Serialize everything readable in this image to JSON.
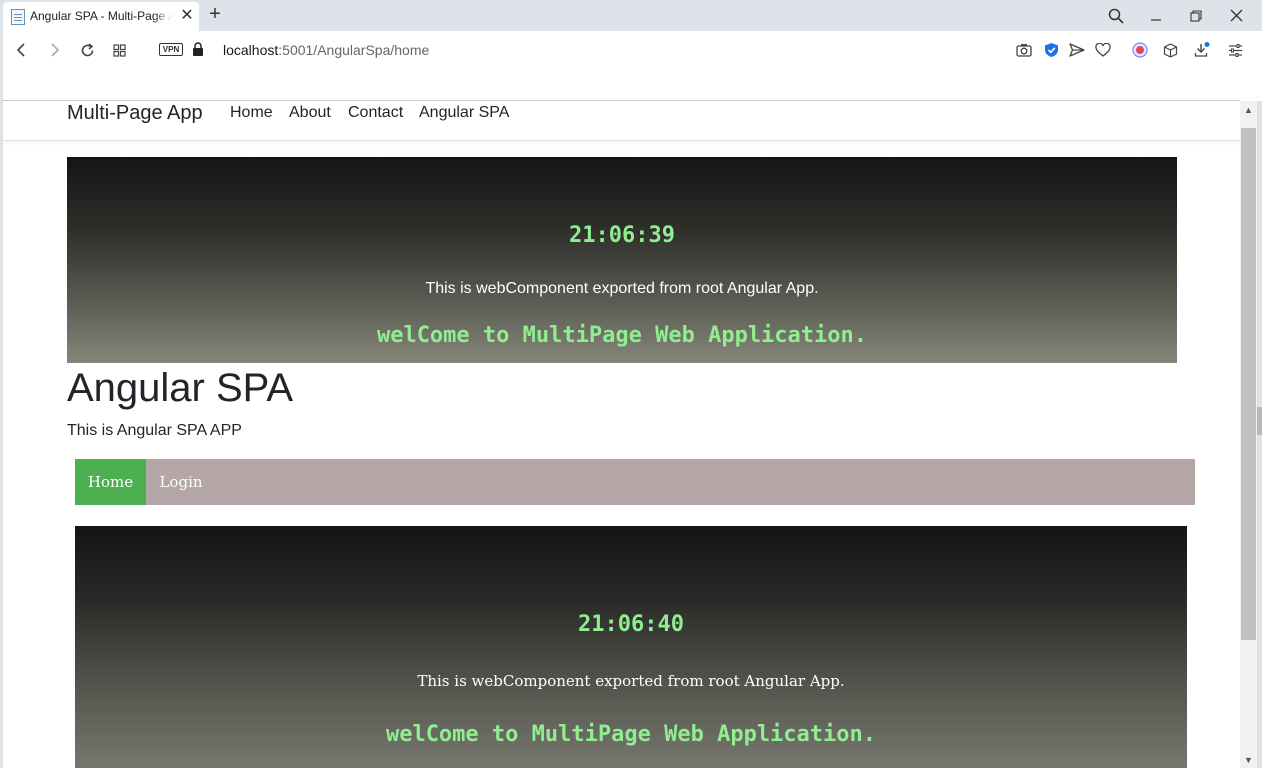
{
  "browser": {
    "tab_title": "Angular SPA - Multi-Page App",
    "new_tab_icon": "plus-icon",
    "url_host": "localhost",
    "url_path": ":5001/AngularSpa/home",
    "vpn_label": "VPN"
  },
  "navbar": {
    "brand": "Multi-Page App",
    "links": [
      "Home",
      "About",
      "Contact",
      "Angular SPA"
    ]
  },
  "root_component": {
    "time": "21:06:39",
    "description": "This is webComponent exported from root Angular App.",
    "welcome": "welCome to MultiPage Web Application."
  },
  "spa": {
    "title": "Angular SPA",
    "subtitle": "This is Angular SPA APP",
    "nav": {
      "items": [
        "Home",
        "Login"
      ],
      "active_color": "#4caf50",
      "bar_color": "#b5a7a7"
    }
  },
  "spa_component": {
    "time": "21:06:40",
    "description": "This is webComponent exported from root Angular App.",
    "welcome": "welCome to MultiPage Web Application."
  },
  "colors": {
    "clock_text": "#90ee90",
    "chrome_bg": "#dee3ea"
  }
}
